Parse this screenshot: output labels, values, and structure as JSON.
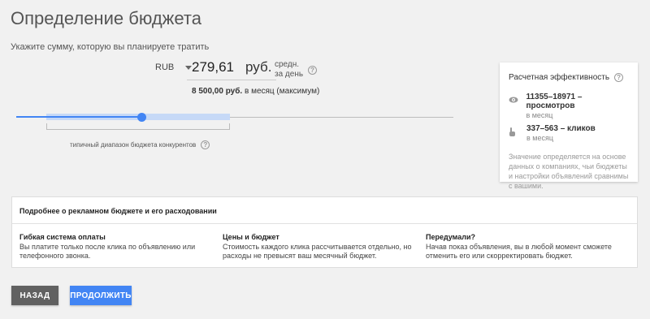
{
  "page": {
    "title": "Определение бюджета",
    "subtitle": "Укажите сумму, которую вы планируете тратить"
  },
  "budget": {
    "currency": "RUB",
    "amount": "279,61",
    "unit": "руб.",
    "period_line1": "средн.",
    "period_line2": "за день",
    "monthly_value": "8 500,00 руб.",
    "monthly_suffix": "в месяц (максимум)"
  },
  "slider": {
    "value_fraction": 0.287,
    "range_label": "типичный диапазон бюджета конкурентов"
  },
  "estimate": {
    "title": "Расчетная эффективность",
    "views_value": "11355–18971",
    "views_label": "– просмотров",
    "views_period": "в месяц",
    "clicks_value": "337–563",
    "clicks_label": "– кликов",
    "clicks_period": "в месяц",
    "note": "Значение определяется на основе данных о компаниях, чьи бюджеты и настройки объявлений сравнимы с вашими."
  },
  "info": {
    "heading": "Подробнее о рекламном бюджете и его расходовании",
    "columns": [
      {
        "title": "Гибкая система оплаты",
        "text": "Вы платите только после клика по объявлению или телефонного звонка."
      },
      {
        "title": "Цены и бюджет",
        "text": "Стоимость каждого клика рассчитывается отдельно, но расходы не превысят ваш месячный бюджет."
      },
      {
        "title": "Передумали?",
        "text": "Начав показ объявления, вы в любой момент сможете отменить его или скорректировать бюджет."
      }
    ]
  },
  "actions": {
    "back_label": "НАЗАД",
    "continue_label": "ПРОДОЛЖИТЬ"
  },
  "colors": {
    "accent": "#4285f4",
    "back_button": "#616161"
  },
  "icons": {
    "help": "help-circle-icon",
    "views": "eye-icon",
    "clicks": "pointer-hand-icon",
    "currency_dropdown": "caret-down-icon"
  }
}
